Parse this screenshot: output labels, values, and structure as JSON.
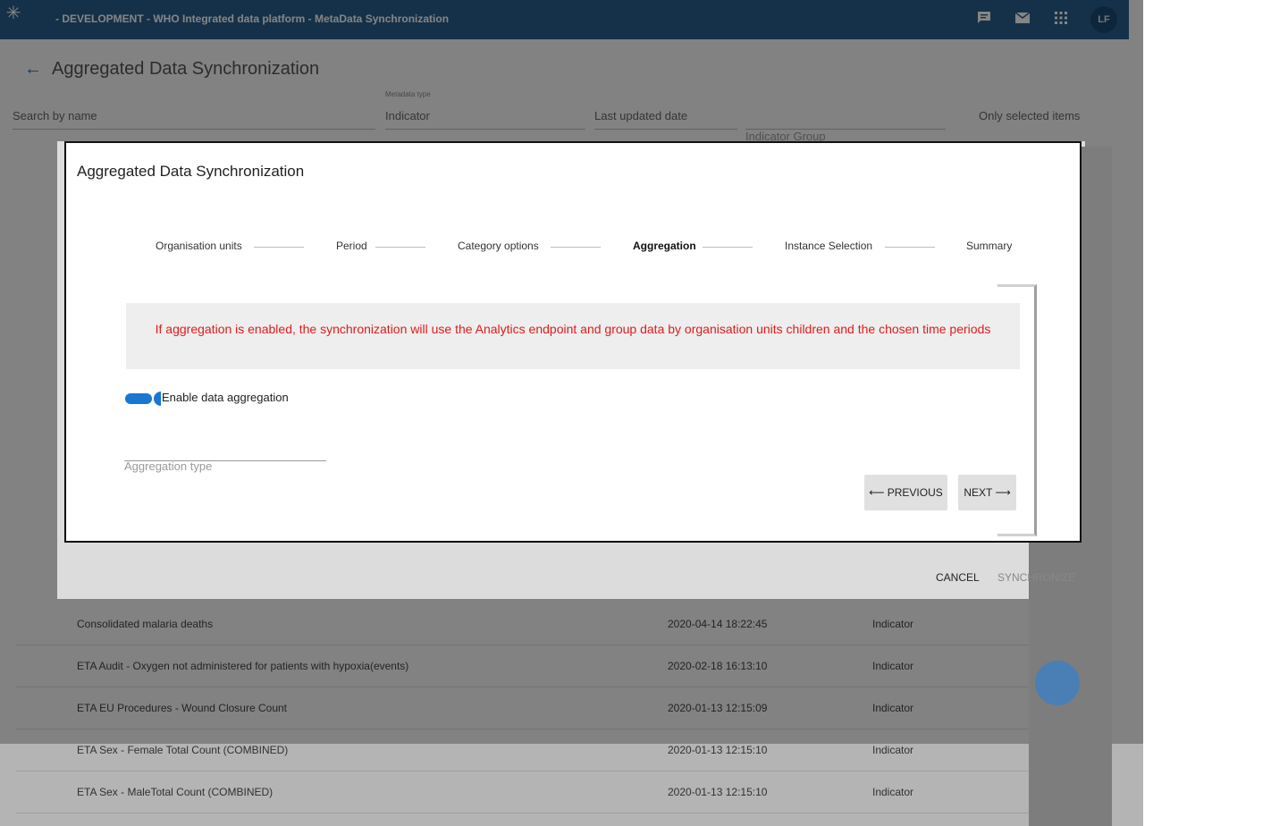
{
  "topbar": {
    "title": "- DEVELOPMENT - WHO Integrated data platform - MetaData Synchronization",
    "avatar": "LF",
    "icons": [
      "chat-icon",
      "mail-icon",
      "apps-icon"
    ]
  },
  "page": {
    "title": "Aggregated Data Synchronization"
  },
  "filters": {
    "search_placeholder": "Search by name",
    "metadata_caption": "Metadata type",
    "metadata_value": "Indicator",
    "last_updated": "Last updated date",
    "group": "Indicator Group",
    "only_selected": "Only selected items"
  },
  "table": {
    "rows": [
      {
        "name": "Consolidated malaria deaths",
        "date": "2020-04-14 18:22:45",
        "type": "Indicator"
      },
      {
        "name": "ETA Audit - Oxygen not administered for patients with hypoxia(events)",
        "date": "2020-02-18 16:13:10",
        "type": "Indicator"
      },
      {
        "name": "ETA EU Procedures - Wound Closure Count",
        "date": "2020-01-13 12:15:09",
        "type": "Indicator"
      },
      {
        "name": "ETA Sex - Female Total Count (COMBINED)",
        "date": "2020-01-13 12:15:10",
        "type": "Indicator"
      },
      {
        "name": "ETA Sex - MaleTotal Count (COMBINED)",
        "date": "2020-01-13 12:15:10",
        "type": "Indicator"
      }
    ]
  },
  "outer_dialog": {
    "cancel": "CANCEL",
    "synchronize": "SYNCHRONIZE"
  },
  "dialog": {
    "title": "Aggregated Data Synchronization",
    "steps": [
      "Organisation units",
      "Period",
      "Category options",
      "Aggregation",
      "Instance Selection",
      "Summary"
    ],
    "active_step": "Aggregation",
    "info": "If aggregation is enabled, the synchronization will use the Analytics endpoint and group data by organisation units children and the chosen time periods",
    "toggle_label": "Enable data aggregation",
    "toggle_on": true,
    "aggregation_type_label": "Aggregation type",
    "previous": "⟵ PREVIOUS",
    "next": "NEXT ⟶"
  },
  "colors": {
    "header": "#2a5f8c",
    "accent": "#1976d2",
    "warning_text": "#e01b1b"
  }
}
